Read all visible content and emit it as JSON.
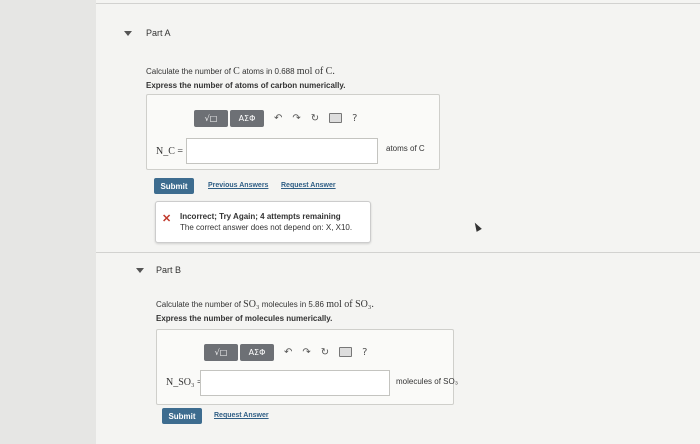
{
  "partA": {
    "title": "Part A",
    "question_prefix": "Calculate the number of",
    "question_symbol": "C",
    "question_mid": "atoms in 0.688",
    "question_unit": "mol of C.",
    "instruction": "Express the number of atoms of carbon numerically.",
    "toolbar": {
      "sqrt": "√□",
      "greek": "ΑΣΦ",
      "help": "?"
    },
    "input_label": "N_C =",
    "input_value": "",
    "unit_label": "atoms of C",
    "submit_label": "Submit",
    "previous_answers": "Previous Answers",
    "request_answer": "Request Answer",
    "feedback_title": "Incorrect; Try Again; 4 attempts remaining",
    "feedback_body": "The correct answer does not depend on: X, X10."
  },
  "partB": {
    "title": "Part B",
    "question_prefix": "Calculate the number of",
    "question_formula": "SO₃",
    "question_mid": "molecules in 5.86",
    "question_unit": "mol of SO₃.",
    "instruction": "Express the number of molecules numerically.",
    "toolbar": {
      "sqrt": "√□",
      "greek": "ΑΣΦ",
      "help": "?"
    },
    "input_label": "N_SO₃ =",
    "input_value": "",
    "unit_label": "molecules of SO₃",
    "submit_label": "Submit",
    "request_answer": "Request Answer"
  }
}
